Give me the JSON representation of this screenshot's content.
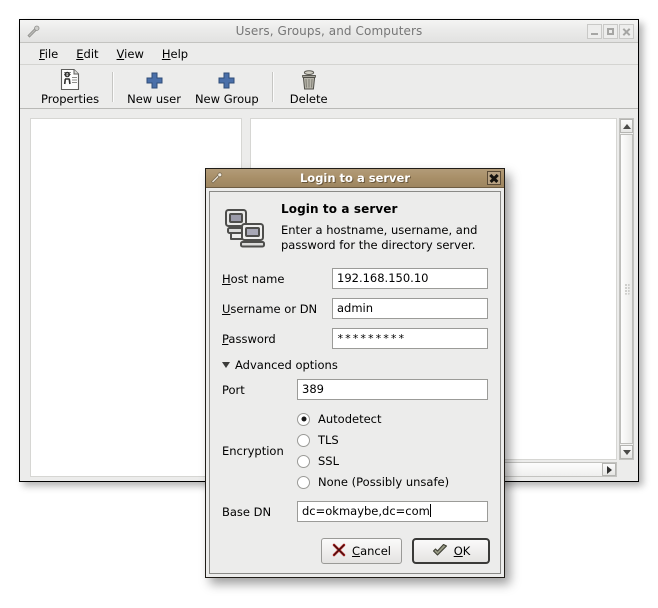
{
  "main_window": {
    "title": "Users, Groups, and Computers",
    "menu_icon": "wrench-icon",
    "window_buttons": {
      "minimize": "minimize-icon",
      "maximize": "maximize-icon",
      "close": "close-icon"
    },
    "menubar": [
      {
        "label": "File",
        "accel": "F"
      },
      {
        "label": "Edit",
        "accel": "E"
      },
      {
        "label": "View",
        "accel": "V"
      },
      {
        "label": "Help",
        "accel": "H"
      }
    ],
    "toolbar": [
      {
        "label": "Properties",
        "icon": "properties-document-icon"
      },
      {
        "separator": true
      },
      {
        "label": "New user",
        "icon": "plus-icon"
      },
      {
        "label": "New Group",
        "icon": "plus-icon"
      },
      {
        "separator": true
      },
      {
        "label": "Delete",
        "icon": "trash-can-icon"
      }
    ],
    "scrollbars": {
      "vertical_up": "triangle-up-icon",
      "vertical_down": "triangle-down-icon",
      "horizontal_right": "triangle-right-icon"
    }
  },
  "dialog": {
    "titlebar": {
      "title": "Login to a server",
      "menu_icon": "wrench-icon",
      "close_icon": "close-icon",
      "color": "#a88f68"
    },
    "header": {
      "icon": "two-computers-icon",
      "title": "Login to a server",
      "description": "Enter a hostname, username, and password for the directory server."
    },
    "fields": [
      {
        "label": "Host name",
        "accel": "H",
        "value": "192.168.150.10",
        "name": "host-name-field"
      },
      {
        "label": "Username or DN",
        "accel": "U",
        "value": "admin",
        "name": "username-field"
      },
      {
        "label": "Password",
        "accel": "P",
        "value": "*********",
        "name": "password-field",
        "masked": true
      }
    ],
    "advanced": {
      "expander_label": "Advanced options",
      "expanded": true,
      "expander_icon": "triangle-down-icon",
      "port": {
        "label": "Port",
        "value": "389"
      },
      "encryption": {
        "label": "Encryption",
        "selected": "Autodetect",
        "options": [
          {
            "label": "Autodetect",
            "checked": true
          },
          {
            "label": "TLS",
            "checked": false
          },
          {
            "label": "SSL",
            "checked": false
          },
          {
            "label": "None (Possibly unsafe)",
            "checked": false
          }
        ]
      },
      "base_dn": {
        "label": "Base DN",
        "value": "dc=okmaybe,dc=com",
        "focused": true
      }
    },
    "buttons": [
      {
        "label": "Cancel",
        "accel": "C",
        "icon": "red-x-icon",
        "default": false,
        "name": "cancel-button"
      },
      {
        "label": "OK",
        "accel": "O",
        "icon": "check-arrow-icon",
        "default": true,
        "name": "ok-button"
      }
    ]
  }
}
